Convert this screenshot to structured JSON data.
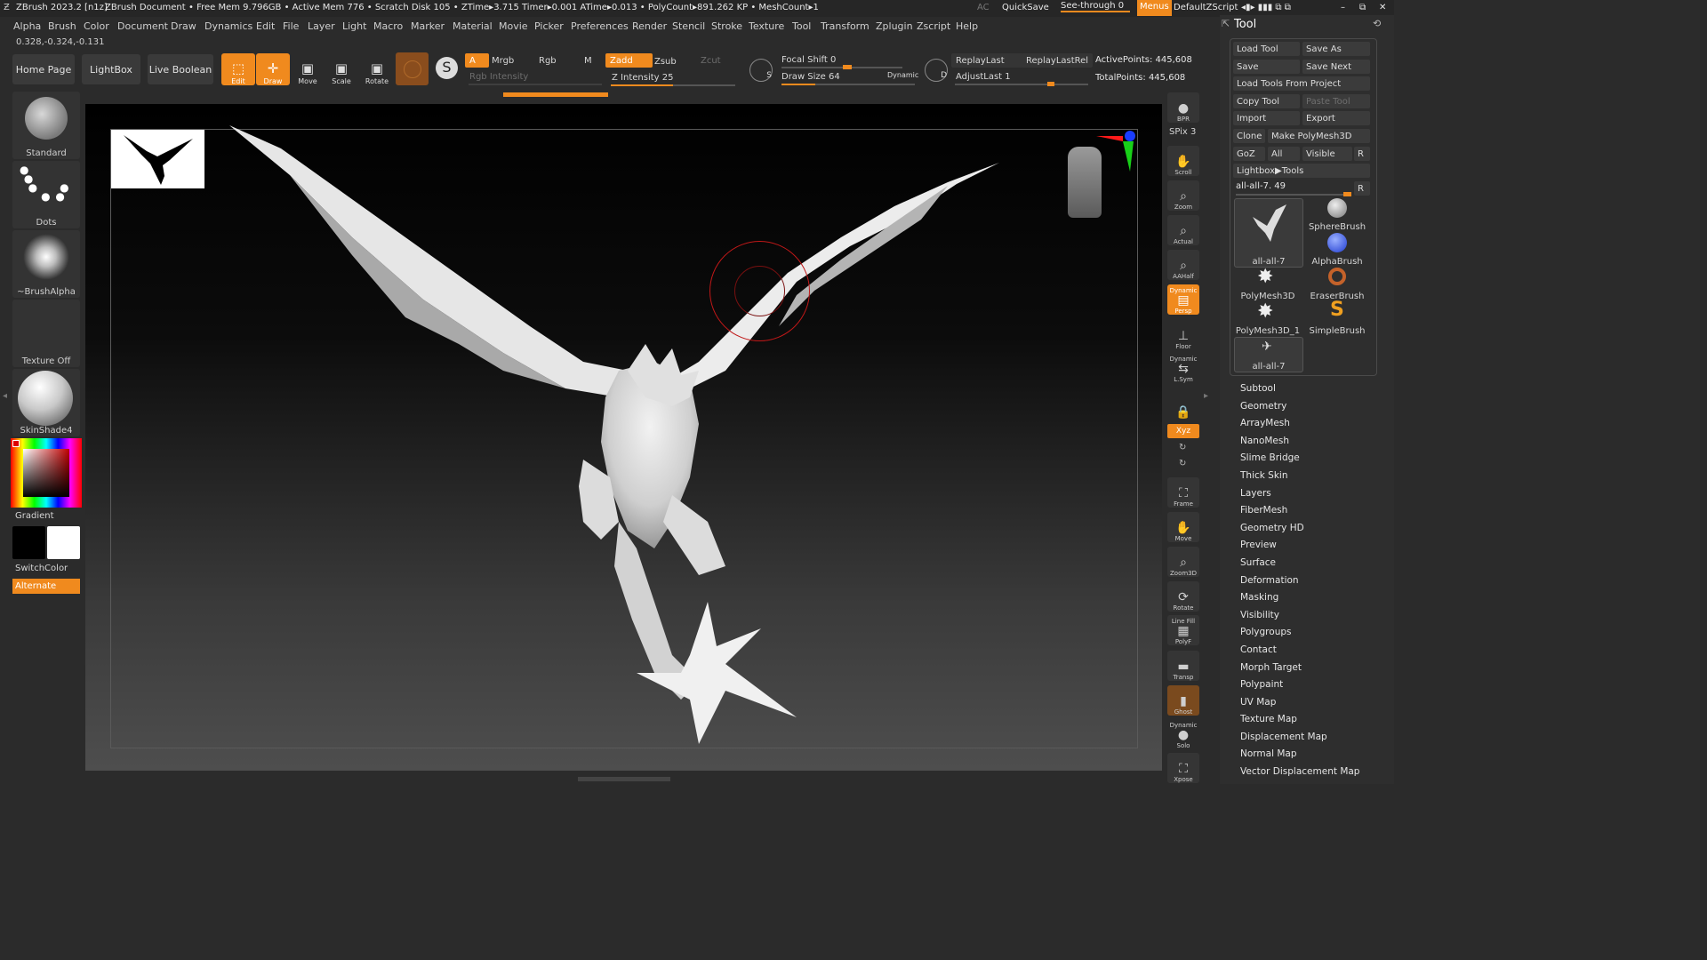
{
  "titlebar": {
    "app": "ZBrush 2023.2 [n1z]",
    "document": "ZBrush Document",
    "stats": "• Free Mem 9.796GB • Active Mem 776 • Scratch Disk 105 • ZTime▸3.715 Timer▸0.001 ATime▸0.013 • PolyCount▸891.262 KP • MeshCount▸1",
    "ac": "AC",
    "quicksave": "QuickSave",
    "seethrough": "See-through  0",
    "menus": "Menus",
    "script": "DefaultZScript"
  },
  "menubar": [
    "Alpha",
    "Brush",
    "Color",
    "Document",
    "Draw",
    "Dynamics",
    "Edit",
    "File",
    "Layer",
    "Light",
    "Macro",
    "Marker",
    "Material",
    "Movie",
    "Picker",
    "Preferences",
    "Render",
    "Stencil",
    "Stroke",
    "Texture",
    "Tool",
    "Transform",
    "Zplugin",
    "Zscript",
    "Help"
  ],
  "coords": "0.328,-0.324,-0.131",
  "shelf": {
    "home": "Home Page",
    "lightbox": "LightBox",
    "liveboolean": "Live Boolean",
    "edit": "Edit",
    "draw": "Draw",
    "move": "Move",
    "scale": "Scale",
    "rotate": "Rotate",
    "a": "A",
    "mrgb": "Mrgb",
    "rgb": "Rgb",
    "m": "M",
    "rgb_intensity": "Rgb Intensity",
    "zadd": "Zadd",
    "zsub": "Zsub",
    "zcut": "Zcut",
    "z_intensity": "Z Intensity 25",
    "s": "S",
    "focal_shift": "Focal Shift 0",
    "draw_size": "Draw Size 64",
    "dynamic": "Dynamic",
    "d": "D",
    "replaylast": "ReplayLast",
    "replaylastrel": "ReplayLastRel",
    "adjustlast": "AdjustLast 1",
    "activepoints": "ActivePoints: 445,608",
    "totalpoints": "TotalPoints: 445,608"
  },
  "left": {
    "standard": "Standard",
    "dots": "Dots",
    "brushalpha": "~BrushAlpha",
    "textureoff": "Texture Off",
    "skinshade": "SkinShade4",
    "gradient": "Gradient",
    "switchcolor": "SwitchColor",
    "alternate": "Alternate"
  },
  "right": {
    "bpr": "BPR",
    "spix": "SPix 3",
    "scroll": "Scroll",
    "zoom": "Zoom",
    "actual": "Actual",
    "aahalf": "AAHalf",
    "dynamic": "Dynamic",
    "persp": "Persp",
    "floor": "Floor",
    "dynamic2": "Dynamic",
    "lsym": "L.Sym",
    "xyz": "Xyz",
    "frame": "Frame",
    "move": "Move",
    "zoom3d": "Zoom3D",
    "rotate": "Rotate",
    "linefill": "Line Fill",
    "polyf": "PolyF",
    "transp": "Transp",
    "ghost": "Ghost",
    "dynamic3": "Dynamic",
    "solo": "Solo",
    "xpose": "Xpose"
  },
  "toolpanel": {
    "title": "Tool",
    "load_tool": "Load Tool",
    "save_as": "Save As",
    "save": "Save",
    "save_next": "Save Next",
    "load_from_project": "Load Tools From Project",
    "copy_tool": "Copy Tool",
    "paste_tool": "Paste Tool",
    "import": "Import",
    "export": "Export",
    "clone": "Clone",
    "make_polymesh": "Make PolyMesh3D",
    "goz": "GoZ",
    "all": "All",
    "visible": "Visible",
    "r": "R",
    "lightbox_tools": "Lightbox▶Tools",
    "current_tool": "all-all-7. 49",
    "r2": "R",
    "thumbs": [
      "all-all-7",
      "SphereBrush",
      "AlphaBrush",
      "PolyMesh3D",
      "EraserBrush",
      "PolyMesh3D_1",
      "SimpleBrush",
      "all-all-7"
    ],
    "subpalettes": [
      "Subtool",
      "Geometry",
      "ArrayMesh",
      "NanoMesh",
      "Slime Bridge",
      "Thick Skin",
      "Layers",
      "FiberMesh",
      "Geometry HD",
      "Preview",
      "Surface",
      "Deformation",
      "Masking",
      "Visibility",
      "Polygroups",
      "Contact",
      "Morph Target",
      "Polypaint",
      "UV Map",
      "Texture Map",
      "Displacement Map",
      "Normal Map",
      "Vector Displacement Map"
    ]
  },
  "colors": {
    "accent": "#f08a1e",
    "background": "#2b2b2b",
    "panel": "#2e2e2e"
  }
}
